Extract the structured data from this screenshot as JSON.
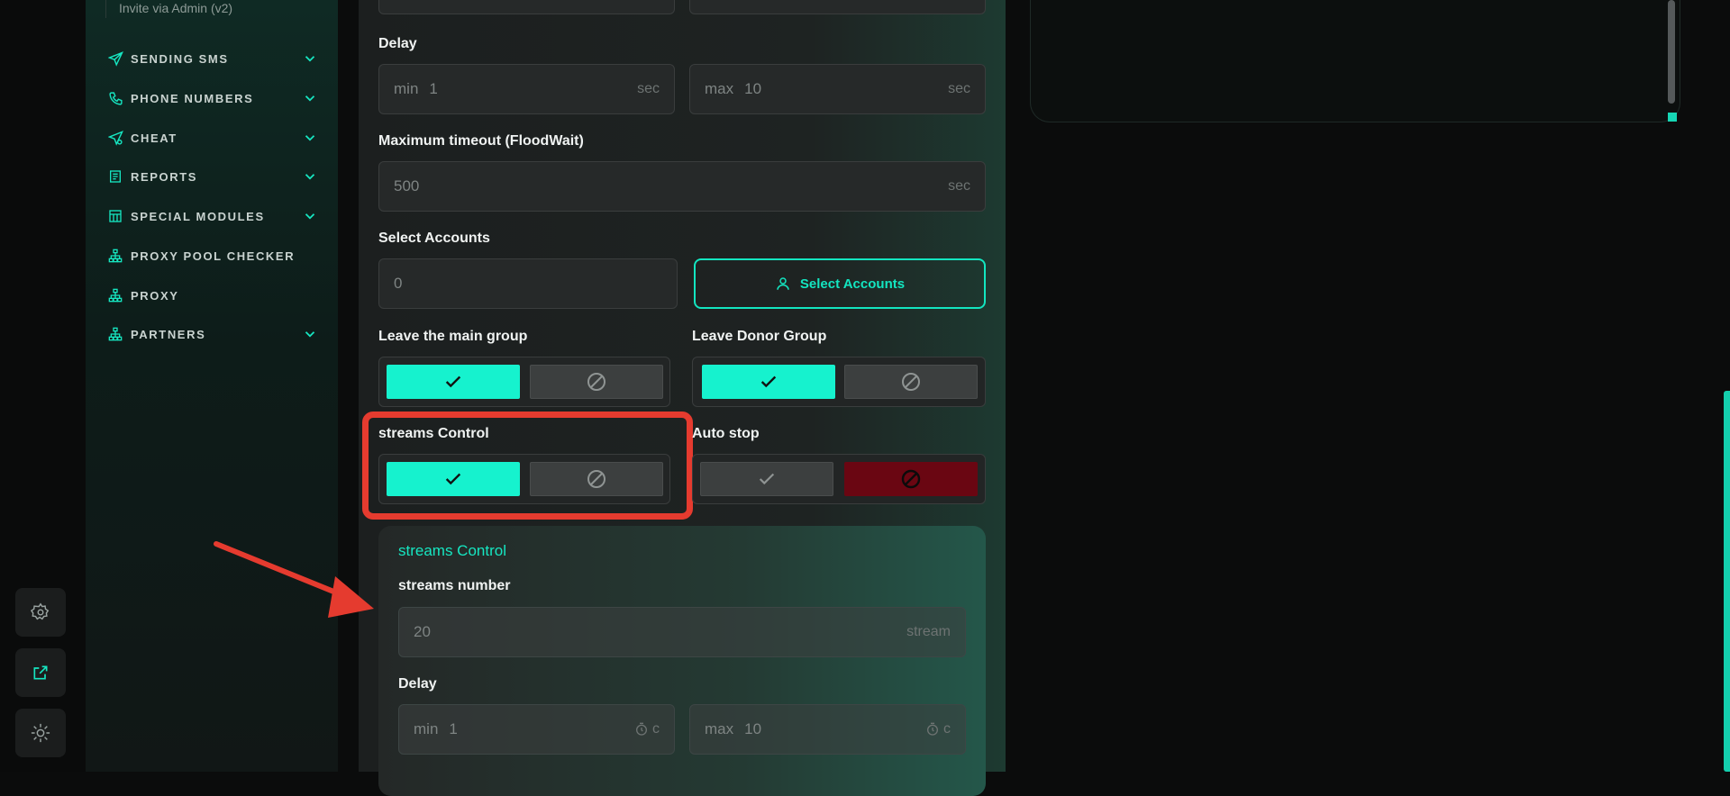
{
  "sidebar": {
    "sub_item": "Invite via Admin (v2)",
    "items": [
      {
        "label": "SENDING SMS",
        "icon": "send-icon",
        "chevron": true
      },
      {
        "label": "PHONE NUMBERS",
        "icon": "phone-icon",
        "chevron": true
      },
      {
        "label": "CHEAT",
        "icon": "send-gear-icon",
        "chevron": true
      },
      {
        "label": "REPORTS",
        "icon": "report-icon",
        "chevron": true
      },
      {
        "label": "SPECIAL MODULES",
        "icon": "table-icon",
        "chevron": true
      },
      {
        "label": "PROXY POOL CHECKER",
        "icon": "network-icon",
        "chevron": false
      },
      {
        "label": "PROXY",
        "icon": "network-icon",
        "chevron": false
      },
      {
        "label": "PARTNERS",
        "icon": "network-icon",
        "chevron": true
      }
    ]
  },
  "rail": {
    "settings_icon": "gear-icon",
    "external_icon": "external-link-icon",
    "theme_icon": "sun-icon"
  },
  "form": {
    "delay": {
      "label": "Delay",
      "min_prefix": "min",
      "min_value": "1",
      "max_prefix": "max",
      "max_value": "10",
      "unit": "sec"
    },
    "timeout": {
      "label": "Maximum timeout (FloodWait)",
      "value": "500",
      "unit": "sec"
    },
    "accounts": {
      "label": "Select Accounts",
      "count": "0",
      "button": "Select Accounts"
    },
    "leave_main": {
      "label": "Leave the main group",
      "state": "on"
    },
    "leave_donor": {
      "label": "Leave Donor Group",
      "state": "on"
    },
    "streams_control": {
      "label": "streams Control",
      "state": "on"
    },
    "auto_stop": {
      "label": "Auto stop",
      "state": "off"
    }
  },
  "streams_card": {
    "title": "streams Control",
    "number_label": "streams number",
    "number_value": "20",
    "number_unit": "stream",
    "delay_label": "Delay",
    "min_prefix": "min",
    "min_value": "1",
    "max_prefix": "max",
    "max_value": "10",
    "unit": "c"
  },
  "colors": {
    "accent": "#16f2ce",
    "highlight": "#e53b2f",
    "stop": "#6a0612"
  }
}
